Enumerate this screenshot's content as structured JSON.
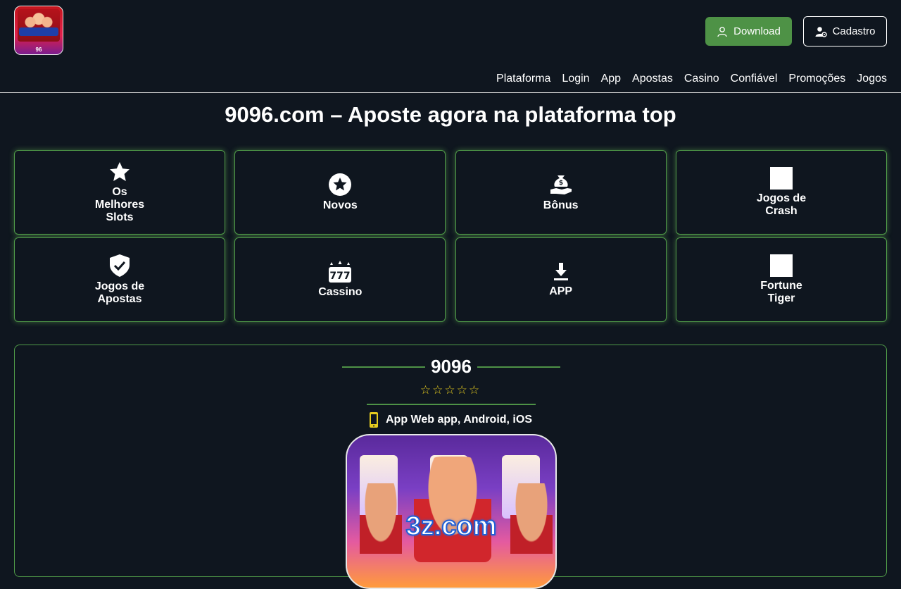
{
  "header": {
    "logo_text": "96",
    "download_label": "Download",
    "cadastro_label": "Cadastro",
    "nav": [
      "Plataforma",
      "Login",
      "App",
      "Apostas",
      "Casino",
      "Confiável",
      "Promoções",
      "Jogos"
    ]
  },
  "page_title": "9096.com – Aposte agora na plataforma top",
  "categories": [
    {
      "label": "Os Melhores Slots",
      "icon": "star-icon"
    },
    {
      "label": "Novos",
      "icon": "star-circle-icon"
    },
    {
      "label": "Bônus",
      "icon": "money-hand-icon"
    },
    {
      "label": "Jogos de Crash",
      "icon": "image-placeholder"
    },
    {
      "label": "Jogos de Apostas",
      "icon": "shield-check-icon"
    },
    {
      "label": "Cassino",
      "icon": "slot-777-icon"
    },
    {
      "label": "APP",
      "icon": "download-icon"
    },
    {
      "label": "Fortune Tiger",
      "icon": "image-placeholder"
    }
  ],
  "app_panel": {
    "brand": "9096",
    "rating": 0,
    "rating_max": 5,
    "platforms": "App Web app, Android, iOS",
    "image_text": "3z.com"
  },
  "colors": {
    "background": "#0f161f",
    "accent_green": "#4e9246",
    "star_yellow": "#e6cc1f"
  }
}
